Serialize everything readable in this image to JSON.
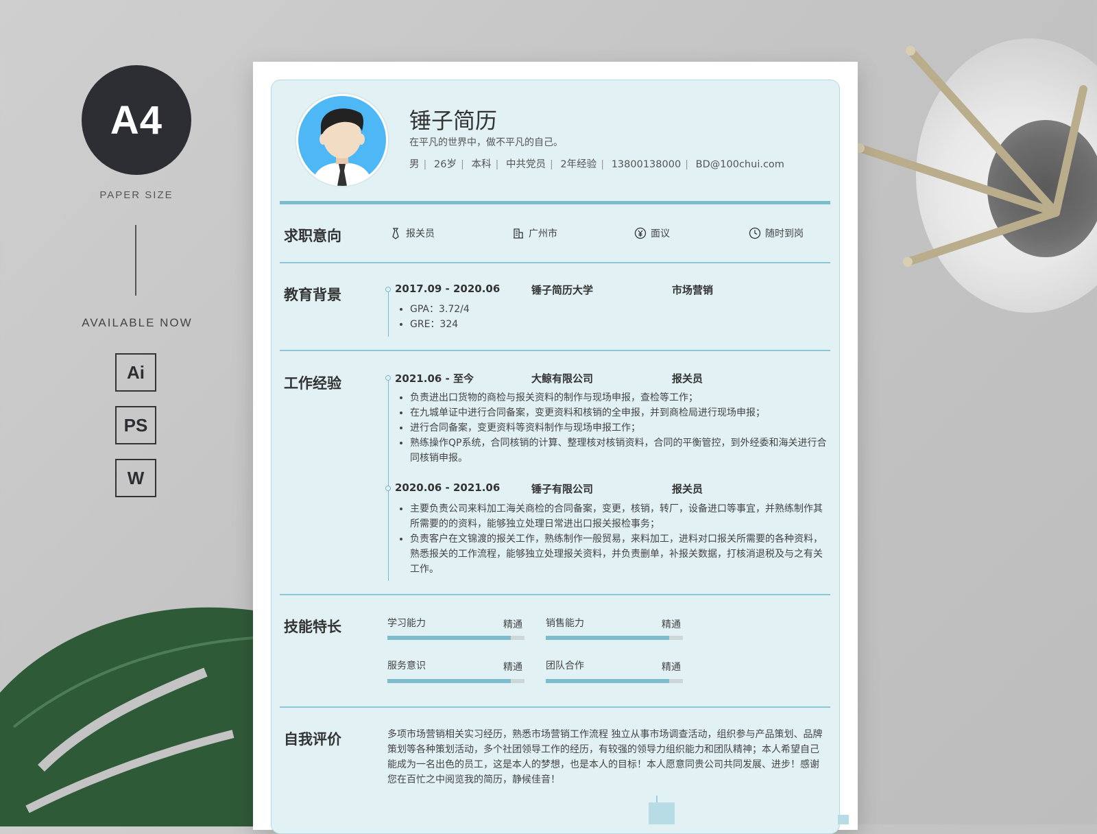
{
  "badge": {
    "size": "A4",
    "paper_size": "PAPER SIZE",
    "available": "AVAILABLE NOW",
    "formats": [
      "Ai",
      "PS",
      "W"
    ]
  },
  "resume": {
    "name": "锤子简历",
    "motto": "在平凡的世界中，做不平凡的自己。",
    "info": [
      "男",
      "26岁",
      "本科",
      "中共党员",
      "2年经验",
      "13800138000",
      "BD@100chui.com"
    ],
    "sections": {
      "intent": "求职意向",
      "education": "教育背景",
      "work": "工作经验",
      "skills": "技能特长",
      "self": "自我评价"
    },
    "intent": {
      "position": "报关员",
      "city": "广州市",
      "salary": "面议",
      "availability": "随时到岗"
    },
    "education": {
      "date": "2017.09 - 2020.06",
      "school": "锤子简历大学",
      "major": "市场营销",
      "items": [
        "GPA：3.72/4",
        "GRE：324"
      ]
    },
    "work": [
      {
        "date": "2021.06 - 至今",
        "company": "大鲸有限公司",
        "role": "报关员",
        "items": [
          "负责进出口货物的商检与报关资料的制作与现场申报，查检等工作；",
          "在九城单证中进行合同备案，变更资料和核销的全申报，并到商检局进行现场申报；",
          "进行合同备案，变更资料等资料制作与现场申报工作；",
          "熟练操作QP系统，合同核销的计算、整理核对核销资料，合同的平衡管控，到外经委和海关进行合同核销申报。"
        ]
      },
      {
        "date": "2020.06 - 2021.06",
        "company": "锤子有限公司",
        "role": "报关员",
        "items": [
          "主要负责公司来料加工海关商检的合同备案，变更，核销，转厂，设备进口等事宜，并熟练制作其所需要的的资料，能够独立处理日常进出口报关报检事务；",
          "负责客户在文锦渡的报关工作，熟练制作一般贸易，来料加工，进料对口报关所需要的各种资料，熟悉报关的工作流程，能够独立处理报关资料，并负责删单，补报关数据，打核消退税及与之有关工作。"
        ]
      }
    ],
    "skills": [
      {
        "name": "学习能力",
        "level": "精通",
        "fill": 0.9
      },
      {
        "name": "销售能力",
        "level": "精通",
        "fill": 0.9
      },
      {
        "name": "服务意识",
        "level": "精通",
        "fill": 0.9
      },
      {
        "name": "团队合作",
        "level": "精通",
        "fill": 0.9
      }
    ],
    "self_eval": "多项市场营销相关实习经历，熟悉市场营销工作流程 独立从事市场调查活动，组织参与产品策划、品牌策划等各种策划活动，多个社团领导工作的经历，有较强的领导力组织能力和团队精神；本人希望自己能成为一名出色的员工，这是本人的梦想，也是本人的目标！本人愿意同贵公司共同发展、进步！感谢您在百忙之中阅览我的简历，静候佳音！"
  },
  "colors": {
    "accent": "#7dbccd",
    "card": "#e2f1f4",
    "avatar_bg": "#4db8f5"
  }
}
